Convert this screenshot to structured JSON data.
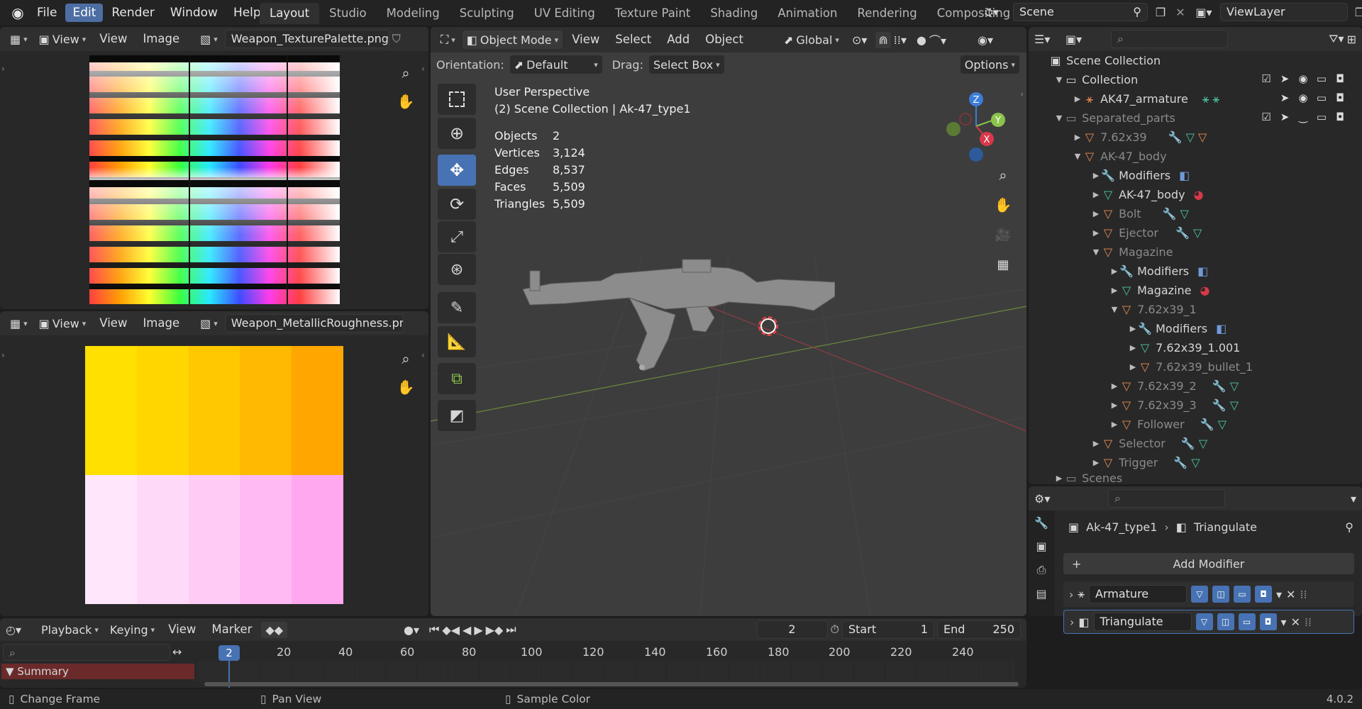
{
  "topbar": {
    "menus": [
      "File",
      "Edit",
      "Render",
      "Window",
      "Help"
    ],
    "active_menu": "Edit",
    "workspaces": [
      "Layout",
      "Studio",
      "Modeling",
      "Sculpting",
      "UV Editing",
      "Texture Paint",
      "Shading",
      "Animation",
      "Rendering",
      "Compositing"
    ],
    "active_workspace": "Layout",
    "scene": "Scene",
    "view_layer": "ViewLayer"
  },
  "image_editor_top": {
    "view": "View",
    "menu_view": "View",
    "menu_image": "Image",
    "image_name": "Weapon_TexturePalette.png"
  },
  "image_editor_bottom": {
    "view": "View",
    "menu_view": "View",
    "menu_image": "Image",
    "image_name": "Weapon_MetallicRoughness.png"
  },
  "viewport": {
    "mode": "Object Mode",
    "menus": [
      "View",
      "Select",
      "Add",
      "Object"
    ],
    "transform": "Global",
    "orientation_label": "Orientation:",
    "orientation_value": "Default",
    "drag_label": "Drag:",
    "drag_value": "Select Box",
    "options": "Options",
    "perspective": "User Perspective",
    "collection_info": "(2) Scene Collection | Ak-47_type1",
    "stats": [
      {
        "label": "Objects",
        "value": "2"
      },
      {
        "label": "Vertices",
        "value": "3,124"
      },
      {
        "label": "Edges",
        "value": "8,537"
      },
      {
        "label": "Faces",
        "value": "5,509"
      },
      {
        "label": "Triangles",
        "value": "5,509"
      }
    ],
    "gizmo": {
      "z": "Z",
      "y": "Y",
      "x": "X"
    }
  },
  "outliner": {
    "items": [
      {
        "label": "Scene Collection"
      },
      {
        "label": "Collection"
      },
      {
        "label": "AK47_armature"
      },
      {
        "label": "Separated_parts"
      },
      {
        "label": "7.62x39"
      },
      {
        "label": "AK-47_body"
      },
      {
        "label": "Modifiers"
      },
      {
        "label": "AK-47_body"
      },
      {
        "label": "Bolt"
      },
      {
        "label": "Ejector"
      },
      {
        "label": "Magazine"
      },
      {
        "label": "Modifiers"
      },
      {
        "label": "Magazine"
      },
      {
        "label": "7.62x39_1"
      },
      {
        "label": "Modifiers"
      },
      {
        "label": "7.62x39_1.001"
      },
      {
        "label": "7.62x39_bullet_1"
      },
      {
        "label": "7.62x39_2"
      },
      {
        "label": "7.62x39_3"
      },
      {
        "label": "Follower"
      },
      {
        "label": "Selector"
      },
      {
        "label": "Trigger"
      },
      {
        "label": "Scenes"
      }
    ]
  },
  "properties": {
    "object": "Ak-47_type1",
    "modifier_crumb": "Triangulate",
    "add_modifier": "Add Modifier",
    "modifiers": [
      {
        "name": "Armature"
      },
      {
        "name": "Triangulate"
      }
    ]
  },
  "timeline": {
    "menus": [
      "Playback",
      "Keying",
      "View",
      "Marker"
    ],
    "current_frame": "2",
    "start_label": "Start",
    "start": "1",
    "end_label": "End",
    "end": "250",
    "ticks": [
      "20",
      "40",
      "60",
      "80",
      "100",
      "120",
      "140",
      "160",
      "180",
      "200",
      "220",
      "240"
    ],
    "channel": "Summary"
  },
  "statusbar": {
    "items": [
      "Change Frame",
      "Pan View",
      "Sample Color"
    ],
    "version": "4.0.2"
  },
  "colors": {
    "accent": "#4772b3",
    "selected": "#4d6ea3",
    "red_axis": "#d9384b",
    "green_axis": "#8bc34a",
    "blue_axis": "#3c7dd9"
  }
}
